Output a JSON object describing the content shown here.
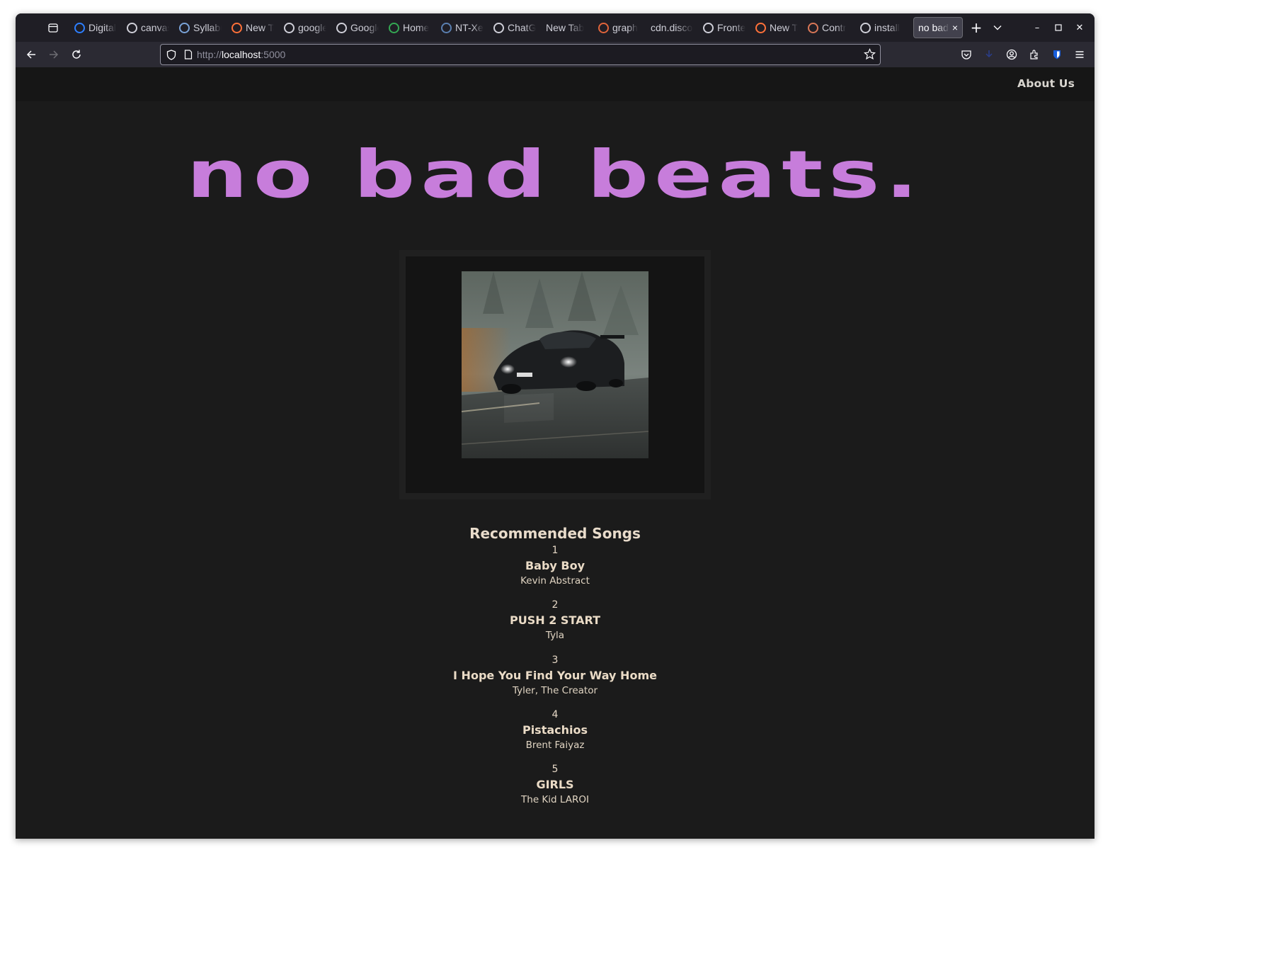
{
  "browser": {
    "tabs": [
      {
        "label": "Digital",
        "icon": "digital-ocean-icon",
        "color": "#2d7fff"
      },
      {
        "label": "canvas",
        "icon": "google-icon",
        "color": "#cfcfd8"
      },
      {
        "label": "Syllabus",
        "icon": "gear-badge-icon",
        "color": "#7aa3d8"
      },
      {
        "label": "New Tab",
        "icon": "firefox-icon",
        "color": "#ff7139"
      },
      {
        "label": "google",
        "icon": "google-icon",
        "color": "#cfcfd8"
      },
      {
        "label": "Google",
        "icon": "google-icon",
        "color": "#cfcfd8"
      },
      {
        "label": "Home",
        "icon": "drive-icon",
        "color": "#34a853"
      },
      {
        "label": "NT-Xent",
        "icon": "tds-icon",
        "color": "#5a7fb0"
      },
      {
        "label": "ChatGPT",
        "icon": "chatgpt-icon",
        "color": "#cfcfd8"
      },
      {
        "label": "New Tab",
        "icon": "none",
        "color": ""
      },
      {
        "label": "graph",
        "icon": "ask-icon",
        "color": "#e0643a"
      },
      {
        "label": "cdn.discord",
        "icon": "none",
        "color": ""
      },
      {
        "label": "Frontend",
        "icon": "chatgpt-icon",
        "color": "#cfcfd8"
      },
      {
        "label": "New Tab",
        "icon": "firefox-icon",
        "color": "#ff7139"
      },
      {
        "label": "Contr",
        "icon": "claude-icon",
        "color": "#d97757"
      },
      {
        "label": "install",
        "icon": "google-icon",
        "color": "#cfcfd8"
      }
    ],
    "active_tab": {
      "label": "no bad",
      "close": "×"
    },
    "new_tab": "+",
    "tab_overflow": "⌄",
    "url": {
      "scheme": "http://",
      "host": "localhost",
      "port": ":5000"
    }
  },
  "site": {
    "nav": {
      "about": "About Us"
    },
    "hero_title": "no bad beats.",
    "album_art": {
      "description_icon": "car-artwork-image"
    },
    "recommended_heading": "Recommended Songs",
    "songs": [
      {
        "rank": "1",
        "title": "Baby Boy",
        "artist": "Kevin Abstract"
      },
      {
        "rank": "2",
        "title": "PUSH 2 START",
        "artist": "Tyla"
      },
      {
        "rank": "3",
        "title": "I Hope You Find Your Way Home",
        "artist": "Tyler, The Creator"
      },
      {
        "rank": "4",
        "title": "Pistachios",
        "artist": "Brent Faiyaz"
      },
      {
        "rank": "5",
        "title": "GIRLS",
        "artist": "The Kid LAROI"
      }
    ]
  },
  "colors": {
    "hero": "#c77ddb",
    "page_bg": "#1b1b1b",
    "text": "#eadbc6"
  }
}
